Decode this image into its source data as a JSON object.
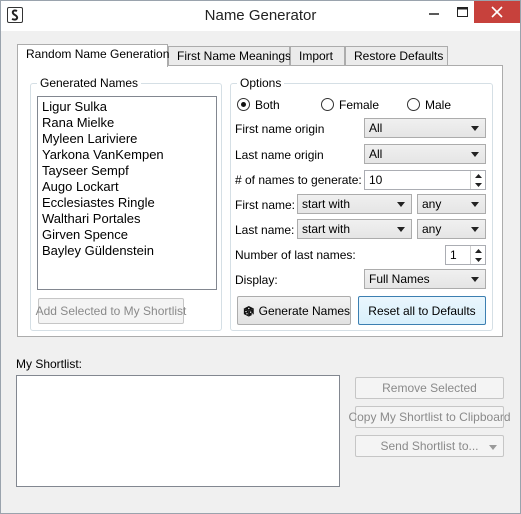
{
  "window": {
    "title": "Name Generator"
  },
  "tabs": [
    {
      "label": "Random Name Generation"
    },
    {
      "label": "First Name Meanings"
    },
    {
      "label": "Import"
    },
    {
      "label": "Restore Defaults"
    }
  ],
  "generated": {
    "group_label": "Generated Names",
    "names": [
      "Ligur Sulka",
      "Rana Mielke",
      "Myleen Lariviere",
      "Yarkona VanKempen",
      "Tayseer Sempf",
      "Augo Lockart",
      "Ecclesiastes Ringle",
      "Walthari Portales",
      "Girven Spence",
      "Bayley Güldenstein"
    ],
    "add_button": "Add Selected to My Shortlist"
  },
  "options": {
    "group_label": "Options",
    "gender": {
      "both": "Both",
      "female": "Female",
      "male": "Male",
      "selected": "Both"
    },
    "first_origin_label": "First name origin",
    "first_origin_value": "All",
    "last_origin_label": "Last name origin",
    "last_origin_value": "All",
    "count_label": "# of names to generate:",
    "count_value": "10",
    "first_name_label": "First name:",
    "first_name_mode": "start with",
    "first_name_letter": "any",
    "last_name_label": "Last name:",
    "last_name_mode": "start with",
    "last_name_letter": "any",
    "num_last_label": "Number of last names:",
    "num_last_value": "1",
    "display_label": "Display:",
    "display_value": "Full Names",
    "generate_button": "Generate Names",
    "reset_button": "Reset all to Defaults"
  },
  "shortlist": {
    "label": "My Shortlist:",
    "remove_button": "Remove Selected",
    "copy_button": "Copy My Shortlist to Clipboard",
    "send_button": "Send Shortlist to..."
  },
  "colors": {
    "close_button": "#c7413c",
    "focus_border": "#3c7fb1"
  }
}
